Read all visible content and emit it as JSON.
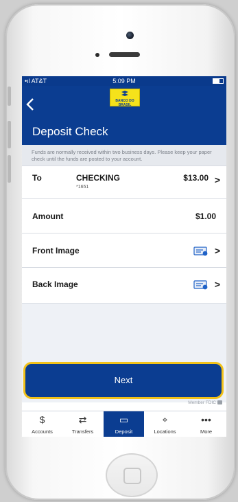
{
  "status_bar": {
    "carrier": "AT&T",
    "time": "5:09 PM"
  },
  "header": {
    "back_icon": "chevron-left-icon",
    "logo_text": "BANCO DO BRASIL",
    "title": "Deposit Check"
  },
  "info_text": "Funds are normally received within two business days. Please keep your paper check until the funds are posted to your account.",
  "rows": {
    "to": {
      "label": "To",
      "account_name": "CHECKING",
      "account_number": "*1651",
      "balance": "$13.00"
    },
    "amount": {
      "label": "Amount",
      "value": "$1.00"
    },
    "front": {
      "label": "Front Image"
    },
    "back": {
      "label": "Back Image"
    }
  },
  "next_button": "Next",
  "fdic": "Member FDIC",
  "tabs": [
    {
      "label": "Accounts",
      "icon": "$"
    },
    {
      "label": "Transfers",
      "icon": "⇄"
    },
    {
      "label": "Deposit",
      "icon": "▭"
    },
    {
      "label": "Locations",
      "icon": "⌖"
    },
    {
      "label": "More",
      "icon": "•••"
    }
  ],
  "colors": {
    "primary": "#0b3d91",
    "highlight": "#f2c21a",
    "logo": "#f5e21b"
  }
}
